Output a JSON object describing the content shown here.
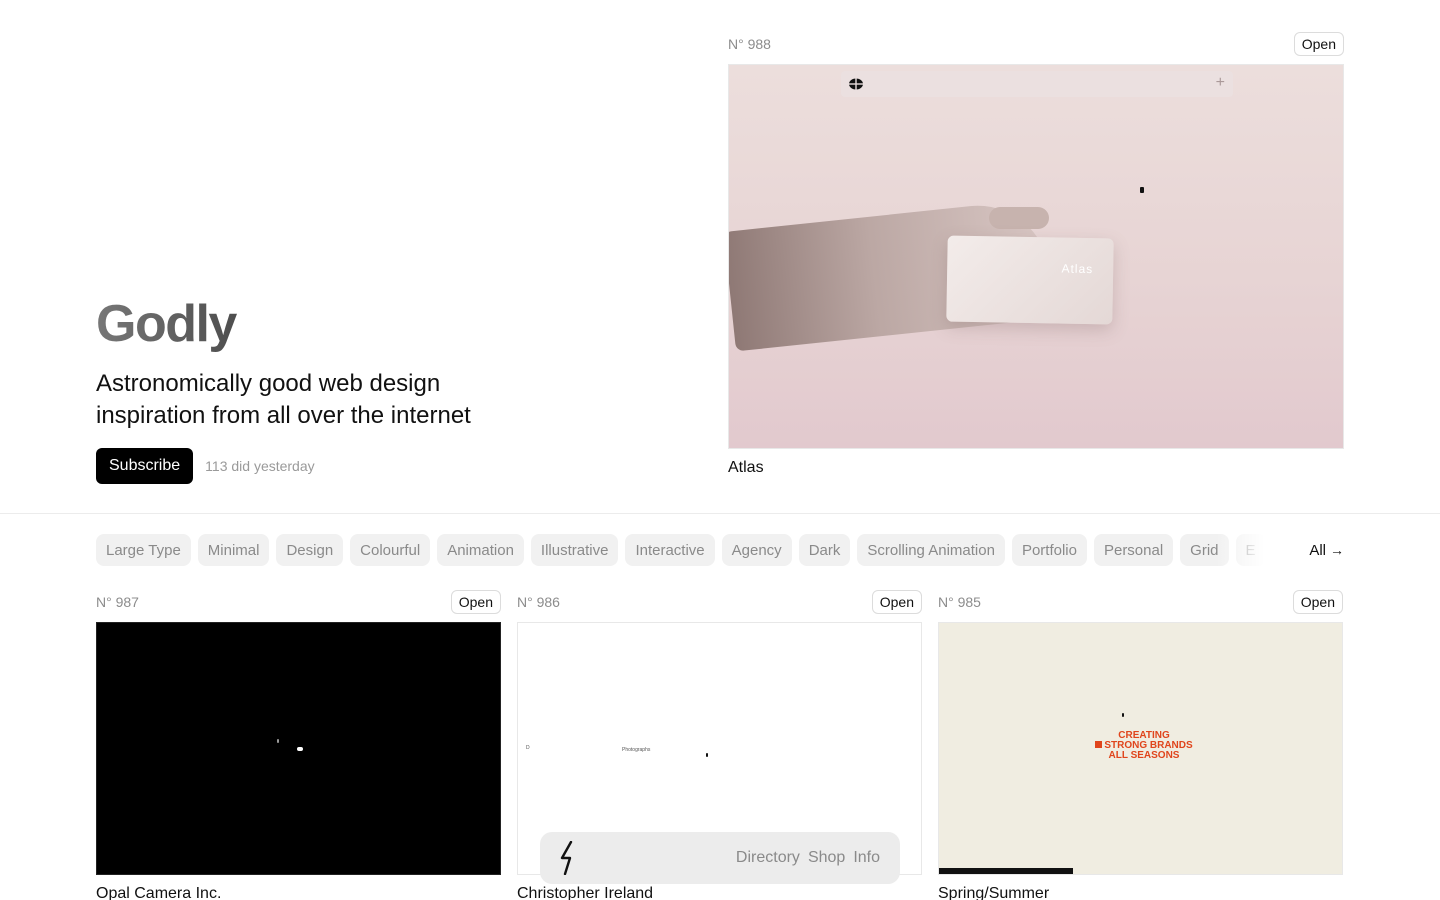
{
  "hero": {
    "title": "Godly",
    "tagline": "Astronomically good web design inspiration from all over the internet",
    "subscribe_label": "Subscribe",
    "subscribe_count": "113 did yesterday"
  },
  "featured": {
    "number": "N° 988",
    "open_label": "Open",
    "title": "Atlas",
    "card_text": "Atlas",
    "bg_color": "#e7d4d4"
  },
  "filters": {
    "chips": [
      "Large Type",
      "Minimal",
      "Design",
      "Colourful",
      "Animation",
      "Illustrative",
      "Interactive",
      "Agency",
      "Dark",
      "Scrolling Animation",
      "Portfolio",
      "Personal",
      "Grid",
      "E"
    ],
    "all_label": "All",
    "all_arrow": "→"
  },
  "grid": [
    {
      "number": "N° 987",
      "open_label": "Open",
      "title": "Opal Camera Inc."
    },
    {
      "number": "N° 986",
      "open_label": "Open",
      "title": "Christopher Ireland",
      "thumb_text_1": "D",
      "thumb_text_2": "Photographs"
    },
    {
      "number": "N° 985",
      "open_label": "Open",
      "title": "Spring/Summer",
      "thumb_lines": [
        "CREATING",
        "STRONG BRANDS",
        "ALL SEASONS"
      ],
      "accent": "#e0451c"
    }
  ],
  "nav": {
    "links": [
      "Directory",
      "Shop",
      "Info"
    ]
  }
}
